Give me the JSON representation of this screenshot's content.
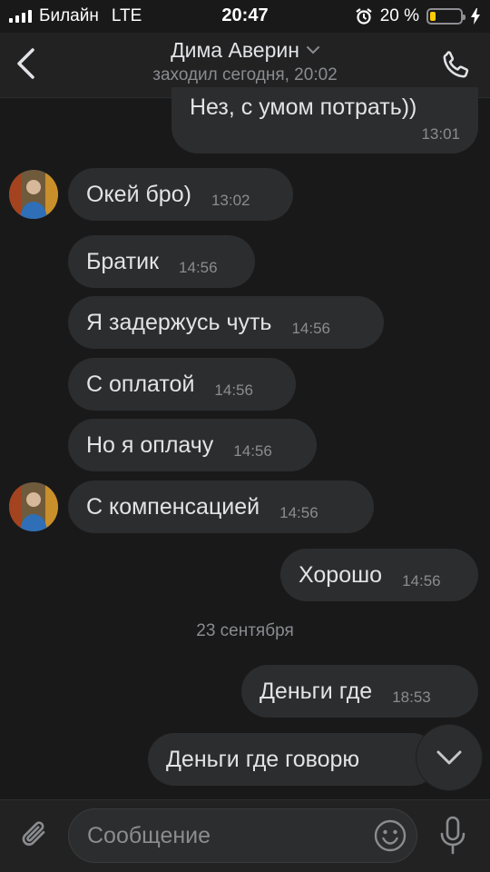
{
  "status_bar": {
    "carrier": "Билайн",
    "network": "LTE",
    "time": "20:47",
    "battery_percent": "20 %",
    "battery_level": 0.2
  },
  "header": {
    "contact_name": "Дима Аверин",
    "last_seen": "заходил сегодня, 20:02"
  },
  "messages": [
    {
      "text": "Нез, с умом потрать))",
      "time": "13:01",
      "direction": "out"
    },
    {
      "text": "Окей бро)",
      "time": "13:02",
      "direction": "in"
    },
    {
      "text": "Братик",
      "time": "14:56",
      "direction": "in"
    },
    {
      "text": "Я задержусь чуть",
      "time": "14:56",
      "direction": "in"
    },
    {
      "text": "С оплатой",
      "time": "14:56",
      "direction": "in"
    },
    {
      "text": "Но я оплачу",
      "time": "14:56",
      "direction": "in"
    },
    {
      "text": "С компенсацией",
      "time": "14:56",
      "direction": "in"
    },
    {
      "text": "Хорошо",
      "time": "14:56",
      "direction": "out"
    },
    {
      "text": "Деньги где",
      "time": "18:53",
      "direction": "out"
    },
    {
      "text": "Деньги где говорю",
      "time": "",
      "direction": "out"
    }
  ],
  "date_separator": "23 сентября",
  "composer": {
    "placeholder": "Сообщение"
  },
  "colors": {
    "background": "#19191a",
    "bubble": "#2c2d2e",
    "bar": "#222223",
    "battery": "#ffcc00"
  },
  "icons": [
    "back-icon",
    "chevron-down-icon",
    "phone-icon",
    "attach-icon",
    "emoji-icon",
    "microphone-icon",
    "alarm-icon",
    "charging-icon"
  ]
}
